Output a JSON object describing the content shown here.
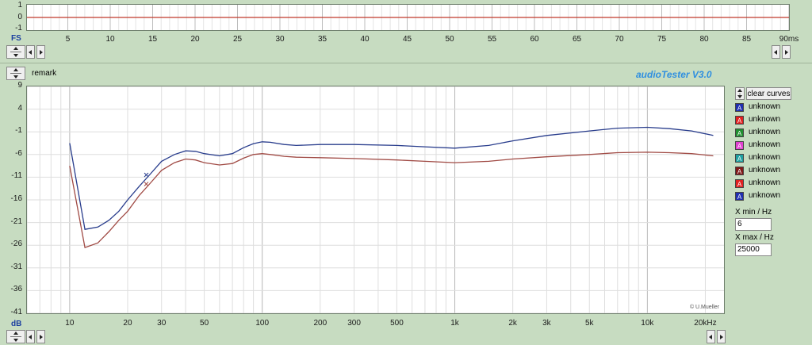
{
  "app": {
    "title": "audioTester  V3.0",
    "title_color": "#2f8fe0",
    "copyright": "© U.Mueller"
  },
  "time_plot": {
    "y_ticks": [
      "1",
      "0",
      "-1"
    ],
    "unit_label": "FS",
    "x_ticks": [
      "5",
      "10",
      "15",
      "20",
      "25",
      "30",
      "35",
      "40",
      "45",
      "50",
      "55",
      "60",
      "65",
      "70",
      "75",
      "80",
      "85",
      "90ms"
    ],
    "trace_color": "#c0392b"
  },
  "remark": {
    "label": "remark"
  },
  "controls": {
    "clear_curves": "clear curves"
  },
  "freq_plot": {
    "y_ticks": [
      "9",
      "4",
      "-1",
      "-6",
      "-11",
      "-16",
      "-21",
      "-26",
      "-31",
      "-36",
      "-41"
    ],
    "unit_label": "dB",
    "x_ticks": [
      {
        "label": "10",
        "f": 10
      },
      {
        "label": "20",
        "f": 20
      },
      {
        "label": "30",
        "f": 30
      },
      {
        "label": "50",
        "f": 50
      },
      {
        "label": "100",
        "f": 100
      },
      {
        "label": "200",
        "f": 200
      },
      {
        "label": "300",
        "f": 300
      },
      {
        "label": "500",
        "f": 500
      },
      {
        "label": "1k",
        "f": 1000
      },
      {
        "label": "2k",
        "f": 2000
      },
      {
        "label": "3k",
        "f": 3000
      },
      {
        "label": "5k",
        "f": 5000
      },
      {
        "label": "10k",
        "f": 10000
      },
      {
        "label": "20kHz",
        "f": 20000
      }
    ]
  },
  "legend": [
    {
      "letter": "A",
      "color": "#1f2fb0",
      "label": "unknown"
    },
    {
      "letter": "A",
      "color": "#e02020",
      "label": "unknown"
    },
    {
      "letter": "A",
      "color": "#1f8f2f",
      "label": "unknown"
    },
    {
      "letter": "A",
      "color": "#e040d0",
      "label": "unknown"
    },
    {
      "letter": "A",
      "color": "#1fa0a0",
      "label": "unknown"
    },
    {
      "letter": "A",
      "color": "#801818",
      "label": "unknown"
    },
    {
      "letter": "A",
      "color": "#e02020",
      "label": "unknown"
    },
    {
      "letter": "A",
      "color": "#1f2fb0",
      "label": "unknown"
    }
  ],
  "xmin": {
    "label": "X min / Hz",
    "value": "6"
  },
  "xmax": {
    "label": "X max / Hz",
    "value": "25000"
  },
  "chart_data": {
    "type": "line",
    "xlabel": "Hz",
    "ylabel": "dB",
    "xscale": "log",
    "xlim": [
      6,
      25000
    ],
    "ylim": [
      -41,
      9
    ],
    "grid": true,
    "series": [
      {
        "color": "#283c8c",
        "x": [
          10,
          12,
          14,
          16,
          18,
          20,
          23,
          26,
          30,
          35,
          40,
          45,
          50,
          60,
          70,
          80,
          90,
          100,
          110,
          130,
          150,
          200,
          300,
          500,
          700,
          1000,
          1500,
          2000,
          3000,
          5000,
          7000,
          10000,
          13000,
          17000,
          22000
        ],
        "y": [
          -3.5,
          -22.5,
          -22.0,
          -20.5,
          -18.5,
          -16.0,
          -13.0,
          -10.5,
          -7.5,
          -6.0,
          -5.2,
          -5.3,
          -5.8,
          -6.3,
          -5.8,
          -4.5,
          -3.6,
          -3.2,
          -3.3,
          -3.8,
          -4.0,
          -3.8,
          -3.8,
          -4.0,
          -4.3,
          -4.6,
          -4.0,
          -3.0,
          -1.8,
          -0.8,
          -0.2,
          0.0,
          -0.3,
          -0.8,
          -1.8
        ]
      },
      {
        "color": "#a04a44",
        "x": [
          10,
          12,
          14,
          16,
          18,
          20,
          23,
          26,
          30,
          35,
          40,
          45,
          50,
          60,
          70,
          80,
          90,
          100,
          110,
          130,
          150,
          200,
          300,
          500,
          700,
          1000,
          1500,
          2000,
          3000,
          5000,
          7000,
          10000,
          13000,
          17000,
          22000
        ],
        "y": [
          -8.5,
          -26.5,
          -25.5,
          -23.0,
          -20.5,
          -18.5,
          -15.0,
          -12.5,
          -9.5,
          -7.8,
          -7.0,
          -7.2,
          -7.8,
          -8.3,
          -8.0,
          -6.8,
          -6.0,
          -5.8,
          -6.0,
          -6.4,
          -6.6,
          -6.7,
          -6.9,
          -7.2,
          -7.5,
          -7.8,
          -7.5,
          -7.0,
          -6.5,
          -6.0,
          -5.6,
          -5.5,
          -5.6,
          -5.8,
          -6.3
        ]
      }
    ],
    "markers": [
      {
        "x": 25,
        "y": -10.5,
        "color": "#283c8c"
      },
      {
        "x": 25,
        "y": -12.5,
        "color": "#a04a44"
      }
    ]
  }
}
